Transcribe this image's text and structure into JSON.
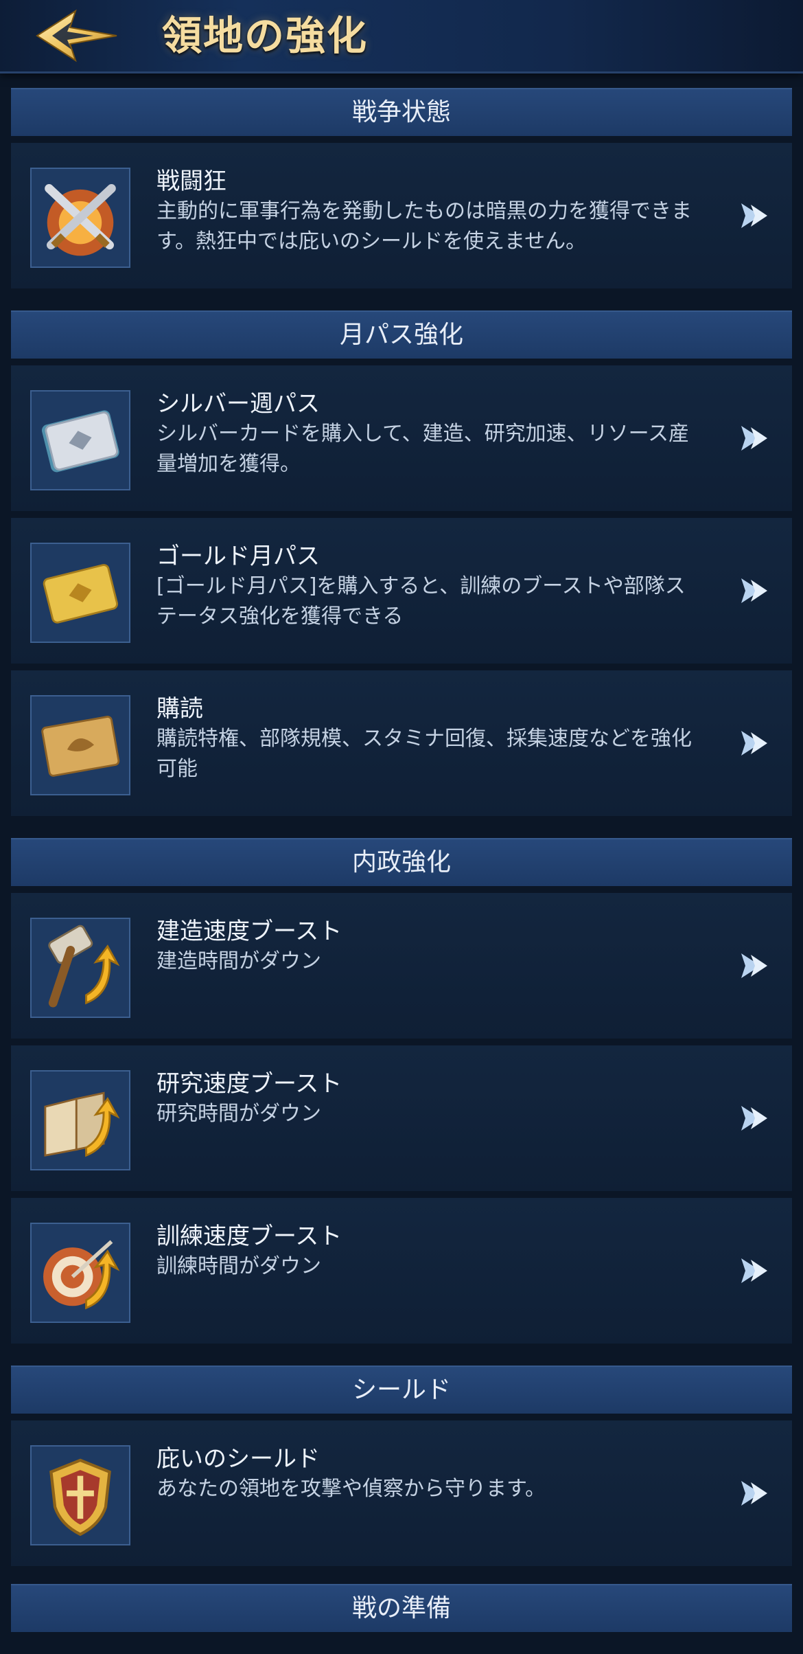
{
  "header": {
    "title": "領地の強化"
  },
  "sections": [
    {
      "label": "戦争状態",
      "items": [
        {
          "title": "戦闘狂",
          "desc": "主動的に軍事行為を発動したものは暗黒の力を獲得できます。熱狂中では庇いのシールドを使えません。",
          "icon": "crossed-swords-icon"
        }
      ]
    },
    {
      "label": "月パス強化",
      "items": [
        {
          "title": "シルバー週パス",
          "desc": "シルバーカードを購入して、建造、研究加速、リソース産量増加を獲得。",
          "icon": "silver-card-icon"
        },
        {
          "title": "ゴールド月パス",
          "desc": "[ゴールド月パス]を購入すると、訓練のブーストや部隊ステータス強化を獲得できる",
          "icon": "gold-card-icon"
        },
        {
          "title": "購読",
          "desc": "購読特権、部隊規模、スタミナ回復、採集速度などを強化可能",
          "icon": "subscription-card-icon"
        }
      ]
    },
    {
      "label": "内政強化",
      "items": [
        {
          "title": "建造速度ブースト",
          "desc": "建造時間がダウン",
          "icon": "hammer-icon"
        },
        {
          "title": "研究速度ブースト",
          "desc": "研究時間がダウン",
          "icon": "book-icon"
        },
        {
          "title": "訓練速度ブースト",
          "desc": "訓練時間がダウン",
          "icon": "target-icon"
        }
      ]
    },
    {
      "label": "シールド",
      "items": [
        {
          "title": "庇いのシールド",
          "desc": "あなたの領地を攻撃や偵察から守ります。",
          "icon": "shield-icon"
        }
      ]
    },
    {
      "label": "戦の準備",
      "items": []
    }
  ]
}
